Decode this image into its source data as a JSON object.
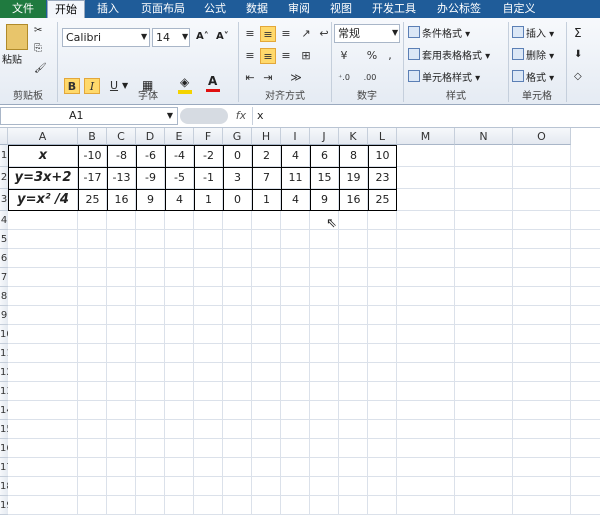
{
  "tabs": [
    "文件",
    "开始",
    "插入",
    "页面布局",
    "公式",
    "数据",
    "审阅",
    "视图",
    "开发工具",
    "办公标签",
    "自定义"
  ],
  "ribbon": {
    "paste_label": "粘贴",
    "groups": [
      "剪贴板",
      "字体",
      "对齐方式",
      "数字",
      "样式",
      "单元格"
    ],
    "font_name": "Calibri",
    "font_size": "14",
    "bold": "B",
    "italic": "I",
    "underline": "U",
    "number_format": "常规",
    "percent": "%",
    "comma": ",",
    "styles": [
      "条件格式",
      "套用表格格式",
      "单元格样式"
    ],
    "cells": [
      "插入",
      "删除",
      "格式"
    ],
    "sigma": "Σ"
  },
  "formula_bar": {
    "name_box": "A1",
    "fx": "fx",
    "content": "x"
  },
  "columns": [
    "A",
    "B",
    "C",
    "D",
    "E",
    "F",
    "G",
    "H",
    "I",
    "J",
    "K",
    "L",
    "M",
    "N",
    "O"
  ],
  "rows": [
    "1",
    "2",
    "3",
    "4",
    "5",
    "6",
    "7",
    "8",
    "9",
    "10",
    "11",
    "12",
    "13",
    "14",
    "15",
    "16",
    "17",
    "18",
    "19"
  ],
  "table": {
    "labels": [
      "x",
      "y=3x+2",
      "y=x² /4"
    ],
    "rows": [
      [
        "-10",
        "-8",
        "-6",
        "-4",
        "-2",
        "0",
        "2",
        "4",
        "6",
        "8",
        "10"
      ],
      [
        "-17",
        "-13",
        "-9",
        "-5",
        "-1",
        "3",
        "7",
        "11",
        "15",
        "19",
        "23"
      ],
      [
        "25",
        "16",
        "9",
        "4",
        "1",
        "0",
        "1",
        "4",
        "9",
        "16",
        "25"
      ]
    ]
  }
}
